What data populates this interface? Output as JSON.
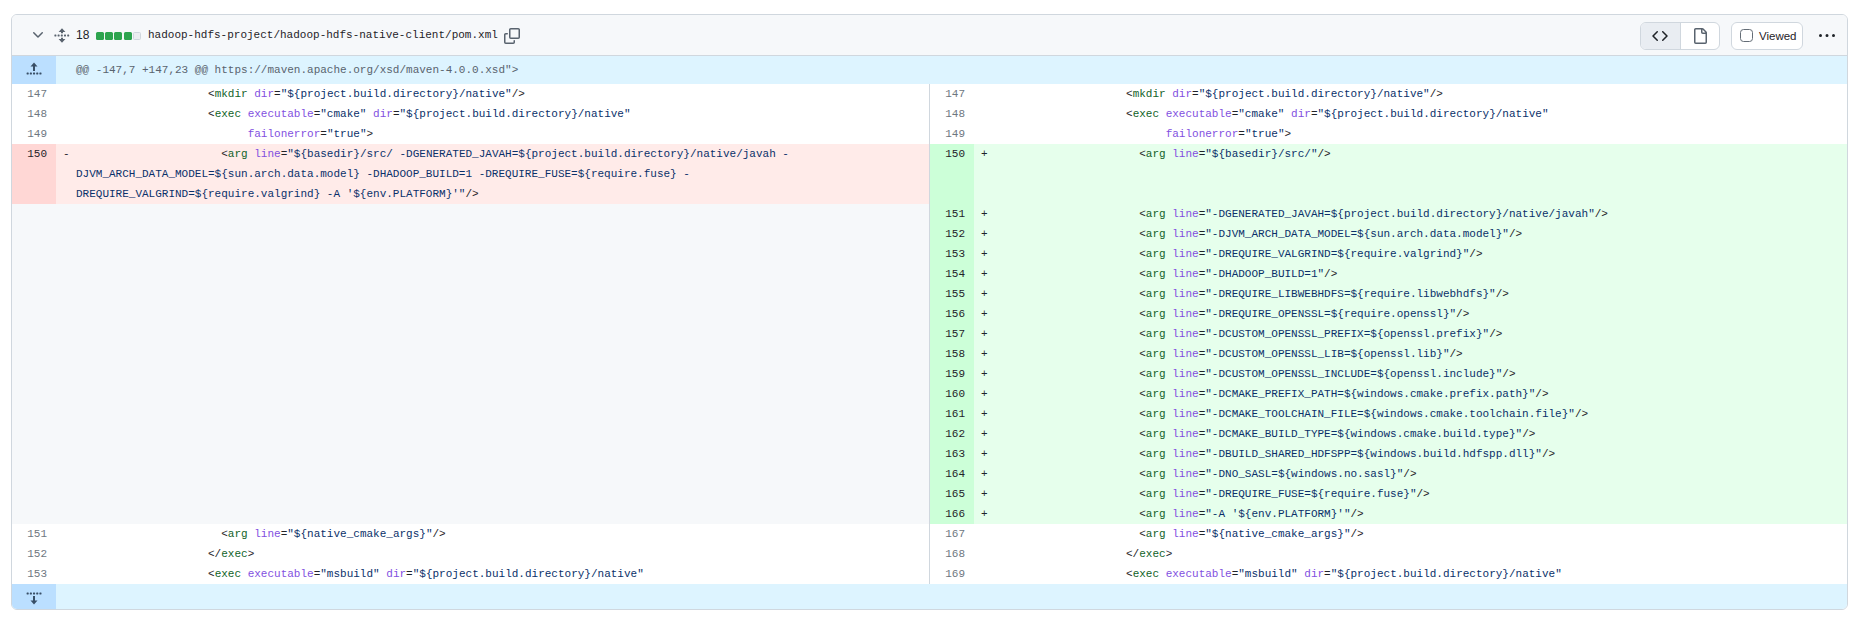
{
  "header": {
    "lines_changed": "18",
    "diffstat": {
      "added": 4,
      "neutral": 1
    },
    "file_path": "hadoop-hdfs-project/hadoop-hdfs-native-client/pom.xml",
    "viewed_label": "Viewed",
    "view_toggle": {
      "source_selected": true
    }
  },
  "hunk": {
    "text": "@@ -147,7 +147,23 @@ https://maven.apache.org/xsd/maven-4.0.0.xsd\">"
  },
  "colors": {
    "border": "#d0d7de",
    "header-bg": "#f6f8fa",
    "fg": "#1f2328",
    "fg-muted": "#59636e",
    "num-fg": "#6e7781",
    "hunk-bg": "#ddf4ff",
    "hunk-num-bg": "#bbdfff",
    "add-bg": "#e6ffec",
    "add-num-bg": "#ccffd8",
    "del-bg": "#ffebe9",
    "del-num-bg": "#ffd7d5",
    "empty-bg": "#f6f8fa",
    "diffstat-green": "#2da44e",
    "syn-tag": "#116329",
    "syn-attr": "#8250df",
    "syn-str": "#0a3069"
  },
  "diff": {
    "lines": {
      "L147": [
        [
          [
            "p",
            "                    <"
          ],
          [
            "t",
            "mkdir"
          ],
          [
            "p",
            " "
          ],
          [
            "a",
            "dir"
          ],
          [
            "p",
            "="
          ],
          [
            "s",
            "\"${project.build.directory}/native\""
          ],
          [
            "p",
            "/>"
          ]
        ]
      ],
      "L148": [
        [
          [
            "p",
            "                    <"
          ],
          [
            "t",
            "exec"
          ],
          [
            "p",
            " "
          ],
          [
            "a",
            "executable"
          ],
          [
            "p",
            "="
          ],
          [
            "s",
            "\"cmake\""
          ],
          [
            "p",
            " "
          ],
          [
            "a",
            "dir"
          ],
          [
            "p",
            "="
          ],
          [
            "s",
            "\"${project.build.directory}/native\""
          ]
        ]
      ],
      "L149": [
        [
          [
            "p",
            "                          "
          ],
          [
            "a",
            "failonerror"
          ],
          [
            "p",
            "="
          ],
          [
            "s",
            "\"true\""
          ],
          [
            "p",
            ">"
          ]
        ]
      ],
      "DEL150": [
        [
          [
            "p",
            "                      <"
          ],
          [
            "t",
            "arg"
          ],
          [
            "p",
            " "
          ],
          [
            "a",
            "line"
          ],
          [
            "p",
            "="
          ],
          [
            "s",
            "\"${basedir}/src/ -DGENERATED_JAVAH=${project.build.directory}/native/javah -"
          ]
        ],
        [
          [
            "s",
            "DJVM_ARCH_DATA_MODEL=${sun.arch.data.model} -DHADOOP_BUILD=1 -DREQUIRE_FUSE=${require.fuse} -"
          ]
        ],
        [
          [
            "s",
            "DREQUIRE_VALGRIND=${require.valgrind} -A '${env.PLATFORM}'\""
          ],
          [
            "p",
            "/>"
          ]
        ]
      ],
      "A150": [
        [
          [
            "p",
            "                      <"
          ],
          [
            "t",
            "arg"
          ],
          [
            "p",
            " "
          ],
          [
            "a",
            "line"
          ],
          [
            "p",
            "="
          ],
          [
            "s",
            "\"${basedir}/src/\""
          ],
          [
            "p",
            "/>"
          ]
        ]
      ],
      "A151": [
        [
          [
            "p",
            "                      <"
          ],
          [
            "t",
            "arg"
          ],
          [
            "p",
            " "
          ],
          [
            "a",
            "line"
          ],
          [
            "p",
            "="
          ],
          [
            "s",
            "\"-DGENERATED_JAVAH=${project.build.directory}/native/javah\""
          ],
          [
            "p",
            "/>"
          ]
        ]
      ],
      "A152": [
        [
          [
            "p",
            "                      <"
          ],
          [
            "t",
            "arg"
          ],
          [
            "p",
            " "
          ],
          [
            "a",
            "line"
          ],
          [
            "p",
            "="
          ],
          [
            "s",
            "\"-DJVM_ARCH_DATA_MODEL=${sun.arch.data.model}\""
          ],
          [
            "p",
            "/>"
          ]
        ]
      ],
      "A153": [
        [
          [
            "p",
            "                      <"
          ],
          [
            "t",
            "arg"
          ],
          [
            "p",
            " "
          ],
          [
            "a",
            "line"
          ],
          [
            "p",
            "="
          ],
          [
            "s",
            "\"-DREQUIRE_VALGRIND=${require.valgrind}\""
          ],
          [
            "p",
            "/>"
          ]
        ]
      ],
      "A154": [
        [
          [
            "p",
            "                      <"
          ],
          [
            "t",
            "arg"
          ],
          [
            "p",
            " "
          ],
          [
            "a",
            "line"
          ],
          [
            "p",
            "="
          ],
          [
            "s",
            "\"-DHADOOP_BUILD=1\""
          ],
          [
            "p",
            "/>"
          ]
        ]
      ],
      "A155": [
        [
          [
            "p",
            "                      <"
          ],
          [
            "t",
            "arg"
          ],
          [
            "p",
            " "
          ],
          [
            "a",
            "line"
          ],
          [
            "p",
            "="
          ],
          [
            "s",
            "\"-DREQUIRE_LIBWEBHDFS=${require.libwebhdfs}\""
          ],
          [
            "p",
            "/>"
          ]
        ]
      ],
      "A156": [
        [
          [
            "p",
            "                      <"
          ],
          [
            "t",
            "arg"
          ],
          [
            "p",
            " "
          ],
          [
            "a",
            "line"
          ],
          [
            "p",
            "="
          ],
          [
            "s",
            "\"-DREQUIRE_OPENSSL=${require.openssl}\""
          ],
          [
            "p",
            "/>"
          ]
        ]
      ],
      "A157": [
        [
          [
            "p",
            "                      <"
          ],
          [
            "t",
            "arg"
          ],
          [
            "p",
            " "
          ],
          [
            "a",
            "line"
          ],
          [
            "p",
            "="
          ],
          [
            "s",
            "\"-DCUSTOM_OPENSSL_PREFIX=${openssl.prefix}\""
          ],
          [
            "p",
            "/>"
          ]
        ]
      ],
      "A158": [
        [
          [
            "p",
            "                      <"
          ],
          [
            "t",
            "arg"
          ],
          [
            "p",
            " "
          ],
          [
            "a",
            "line"
          ],
          [
            "p",
            "="
          ],
          [
            "s",
            "\"-DCUSTOM_OPENSSL_LIB=${openssl.lib}\""
          ],
          [
            "p",
            "/>"
          ]
        ]
      ],
      "A159": [
        [
          [
            "p",
            "                      <"
          ],
          [
            "t",
            "arg"
          ],
          [
            "p",
            " "
          ],
          [
            "a",
            "line"
          ],
          [
            "p",
            "="
          ],
          [
            "s",
            "\"-DCUSTOM_OPENSSL_INCLUDE=${openssl.include}\""
          ],
          [
            "p",
            "/>"
          ]
        ]
      ],
      "A160": [
        [
          [
            "p",
            "                      <"
          ],
          [
            "t",
            "arg"
          ],
          [
            "p",
            " "
          ],
          [
            "a",
            "line"
          ],
          [
            "p",
            "="
          ],
          [
            "s",
            "\"-DCMAKE_PREFIX_PATH=${windows.cmake.prefix.path}\""
          ],
          [
            "p",
            "/>"
          ]
        ]
      ],
      "A161": [
        [
          [
            "p",
            "                      <"
          ],
          [
            "t",
            "arg"
          ],
          [
            "p",
            " "
          ],
          [
            "a",
            "line"
          ],
          [
            "p",
            "="
          ],
          [
            "s",
            "\"-DCMAKE_TOOLCHAIN_FILE=${windows.cmake.toolchain.file}\""
          ],
          [
            "p",
            "/>"
          ]
        ]
      ],
      "A162": [
        [
          [
            "p",
            "                      <"
          ],
          [
            "t",
            "arg"
          ],
          [
            "p",
            " "
          ],
          [
            "a",
            "line"
          ],
          [
            "p",
            "="
          ],
          [
            "s",
            "\"-DCMAKE_BUILD_TYPE=${windows.cmake.build.type}\""
          ],
          [
            "p",
            "/>"
          ]
        ]
      ],
      "A163": [
        [
          [
            "p",
            "                      <"
          ],
          [
            "t",
            "arg"
          ],
          [
            "p",
            " "
          ],
          [
            "a",
            "line"
          ],
          [
            "p",
            "="
          ],
          [
            "s",
            "\"-DBUILD_SHARED_HDFSPP=${windows.build.hdfspp.dll}\""
          ],
          [
            "p",
            "/>"
          ]
        ]
      ],
      "A164": [
        [
          [
            "p",
            "                      <"
          ],
          [
            "t",
            "arg"
          ],
          [
            "p",
            " "
          ],
          [
            "a",
            "line"
          ],
          [
            "p",
            "="
          ],
          [
            "s",
            "\"-DNO_SASL=${windows.no.sasl}\""
          ],
          [
            "p",
            "/>"
          ]
        ]
      ],
      "A165": [
        [
          [
            "p",
            "                      <"
          ],
          [
            "t",
            "arg"
          ],
          [
            "p",
            " "
          ],
          [
            "a",
            "line"
          ],
          [
            "p",
            "="
          ],
          [
            "s",
            "\"-DREQUIRE_FUSE=${require.fuse}\""
          ],
          [
            "p",
            "/>"
          ]
        ]
      ],
      "A166": [
        [
          [
            "p",
            "                      <"
          ],
          [
            "t",
            "arg"
          ],
          [
            "p",
            " "
          ],
          [
            "a",
            "line"
          ],
          [
            "p",
            "="
          ],
          [
            "s",
            "\"-A '${env.PLATFORM}'\""
          ],
          [
            "p",
            "/>"
          ]
        ]
      ],
      "L167": [
        [
          [
            "p",
            "                      <"
          ],
          [
            "t",
            "arg"
          ],
          [
            "p",
            " "
          ],
          [
            "a",
            "line"
          ],
          [
            "p",
            "="
          ],
          [
            "s",
            "\"${native_cmake_args}\""
          ],
          [
            "p",
            "/>"
          ]
        ]
      ],
      "L168": [
        [
          [
            "p",
            "                    </"
          ],
          [
            "t",
            "exec"
          ],
          [
            "p",
            ">"
          ]
        ]
      ],
      "L169": [
        [
          [
            "p",
            "                    <"
          ],
          [
            "t",
            "exec"
          ],
          [
            "p",
            " "
          ],
          [
            "a",
            "executable"
          ],
          [
            "p",
            "="
          ],
          [
            "s",
            "\"msbuild\""
          ],
          [
            "p",
            " "
          ],
          [
            "a",
            "dir"
          ],
          [
            "p",
            "="
          ],
          [
            "s",
            "\"${project.build.directory}/native\""
          ]
        ]
      ]
    },
    "rows": [
      {
        "l": {
          "n": "147",
          "t": "ctx",
          "k": "L147"
        },
        "r": {
          "n": "147",
          "t": "ctx",
          "k": "L147"
        }
      },
      {
        "l": {
          "n": "148",
          "t": "ctx",
          "k": "L148"
        },
        "r": {
          "n": "148",
          "t": "ctx",
          "k": "L148"
        }
      },
      {
        "l": {
          "n": "149",
          "t": "ctx",
          "k": "L149"
        },
        "r": {
          "n": "149",
          "t": "ctx",
          "k": "L149"
        }
      },
      {
        "l": {
          "n": "150",
          "t": "del",
          "sign": "-",
          "k": "DEL150"
        },
        "r": {
          "n": "150",
          "t": "add",
          "sign": "+",
          "k": "A150"
        }
      },
      {
        "l": {
          "t": "empty"
        },
        "r": {
          "n": "151",
          "t": "add",
          "sign": "+",
          "k": "A151"
        }
      },
      {
        "l": {
          "t": "empty"
        },
        "r": {
          "n": "152",
          "t": "add",
          "sign": "+",
          "k": "A152"
        }
      },
      {
        "l": {
          "t": "empty"
        },
        "r": {
          "n": "153",
          "t": "add",
          "sign": "+",
          "k": "A153"
        }
      },
      {
        "l": {
          "t": "empty"
        },
        "r": {
          "n": "154",
          "t": "add",
          "sign": "+",
          "k": "A154"
        }
      },
      {
        "l": {
          "t": "empty"
        },
        "r": {
          "n": "155",
          "t": "add",
          "sign": "+",
          "k": "A155"
        }
      },
      {
        "l": {
          "t": "empty"
        },
        "r": {
          "n": "156",
          "t": "add",
          "sign": "+",
          "k": "A156"
        }
      },
      {
        "l": {
          "t": "empty"
        },
        "r": {
          "n": "157",
          "t": "add",
          "sign": "+",
          "k": "A157"
        }
      },
      {
        "l": {
          "t": "empty"
        },
        "r": {
          "n": "158",
          "t": "add",
          "sign": "+",
          "k": "A158"
        }
      },
      {
        "l": {
          "t": "empty"
        },
        "r": {
          "n": "159",
          "t": "add",
          "sign": "+",
          "k": "A159"
        }
      },
      {
        "l": {
          "t": "empty"
        },
        "r": {
          "n": "160",
          "t": "add",
          "sign": "+",
          "k": "A160"
        }
      },
      {
        "l": {
          "t": "empty"
        },
        "r": {
          "n": "161",
          "t": "add",
          "sign": "+",
          "k": "A161"
        }
      },
      {
        "l": {
          "t": "empty"
        },
        "r": {
          "n": "162",
          "t": "add",
          "sign": "+",
          "k": "A162"
        }
      },
      {
        "l": {
          "t": "empty"
        },
        "r": {
          "n": "163",
          "t": "add",
          "sign": "+",
          "k": "A163"
        }
      },
      {
        "l": {
          "t": "empty"
        },
        "r": {
          "n": "164",
          "t": "add",
          "sign": "+",
          "k": "A164"
        }
      },
      {
        "l": {
          "t": "empty"
        },
        "r": {
          "n": "165",
          "t": "add",
          "sign": "+",
          "k": "A165"
        }
      },
      {
        "l": {
          "t": "empty"
        },
        "r": {
          "n": "166",
          "t": "add",
          "sign": "+",
          "k": "A166"
        }
      },
      {
        "l": {
          "n": "151",
          "t": "ctx",
          "k": "L167"
        },
        "r": {
          "n": "167",
          "t": "ctx",
          "k": "L167"
        }
      },
      {
        "l": {
          "n": "152",
          "t": "ctx",
          "k": "L168"
        },
        "r": {
          "n": "168",
          "t": "ctx",
          "k": "L168"
        }
      },
      {
        "l": {
          "n": "153",
          "t": "ctx",
          "k": "L169"
        },
        "r": {
          "n": "169",
          "t": "ctx",
          "k": "L169"
        }
      }
    ]
  }
}
